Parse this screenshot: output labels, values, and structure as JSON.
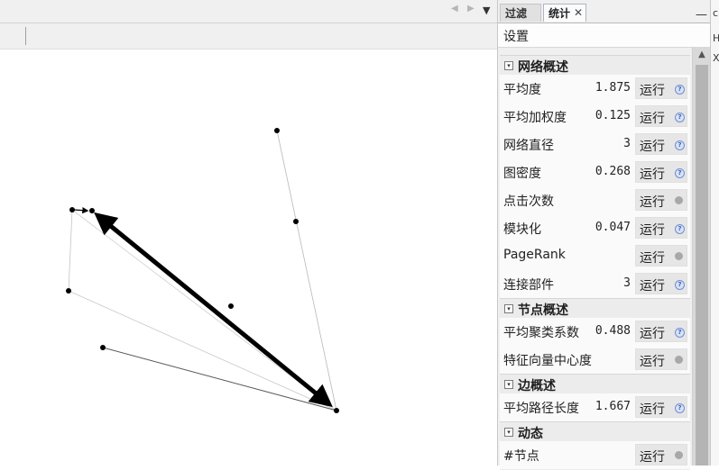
{
  "graph": {
    "nav": {
      "left_icon": "◀",
      "right_icon": "▶",
      "menu_icon": "▼"
    }
  },
  "panel": {
    "tabs": [
      {
        "label": "过滤"
      },
      {
        "label": "统计"
      }
    ],
    "close_icon": "✕",
    "minimize_icon": "—",
    "settings_label": "设置",
    "sections": [
      {
        "title": "网络概述",
        "toggle": "▾"
      },
      {
        "title": "节点概述",
        "toggle": "▾"
      },
      {
        "title": "边概述",
        "toggle": "▾"
      },
      {
        "title": "动态",
        "toggle": "▾"
      }
    ],
    "rows": [
      {
        "label": "平均度",
        "value": "1.875",
        "button": "运行",
        "icon": "help-icon"
      },
      {
        "label": "平均加权度",
        "value": "0.125",
        "button": "运行",
        "icon": "help-icon"
      },
      {
        "label": "网络直径",
        "value": "3",
        "button": "运行",
        "icon": "help-icon"
      },
      {
        "label": "图密度",
        "value": "0.268",
        "button": "运行",
        "icon": "help-icon"
      },
      {
        "label": "点击次数",
        "value": "",
        "button": "运行",
        "icon": "dot-icon"
      },
      {
        "label": "模块化",
        "value": "0.047",
        "button": "运行",
        "icon": "help-icon"
      },
      {
        "label": "PageRank",
        "value": "",
        "button": "运行",
        "icon": "dot-icon"
      },
      {
        "label": "连接部件",
        "value": "3",
        "button": "运行",
        "icon": "help-icon"
      },
      {
        "label": "平均聚类系数",
        "value": "0.488",
        "button": "运行",
        "icon": "help-icon"
      },
      {
        "label": "特征向量中心度",
        "value": "",
        "button": "运行",
        "icon": "dot-icon"
      },
      {
        "label": "平均路径长度",
        "value": "1.667",
        "button": "运行",
        "icon": "help-icon"
      },
      {
        "label": "#节点",
        "value": "",
        "button": "运行",
        "icon": "dot-icon"
      }
    ],
    "help_glyph": "?"
  },
  "edge_strip": {
    "chars": [
      "c",
      "H",
      "X"
    ]
  }
}
